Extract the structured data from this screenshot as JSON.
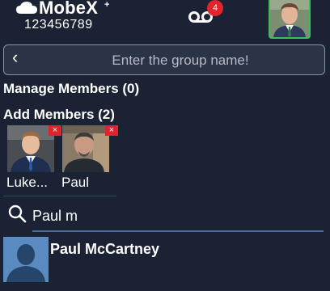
{
  "header": {
    "brand": "MobeX",
    "brand_suffix": "+",
    "phone_number": "123456789",
    "voicemail_count": "4"
  },
  "group_form": {
    "back_label": "‹",
    "name_placeholder": "Enter the group name!",
    "name_value": ""
  },
  "manage_members": {
    "title": "Manage Members (0)"
  },
  "add_members": {
    "title": "Add Members (2)",
    "remove_symbol": "×",
    "members": [
      {
        "name": "Luke..."
      },
      {
        "name": "Paul"
      }
    ]
  },
  "search": {
    "value": "Paul m"
  },
  "results": [
    {
      "name": "Paul McCartney"
    }
  ]
}
